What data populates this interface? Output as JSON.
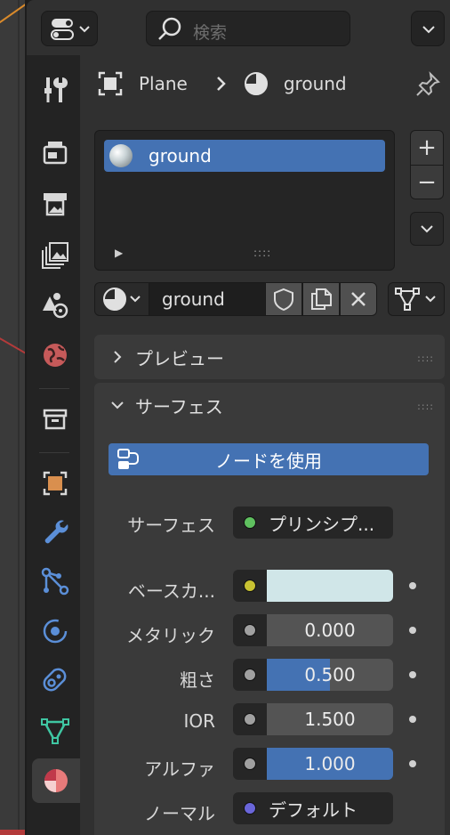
{
  "header": {
    "search_placeholder": "検索"
  },
  "breadcrumb": {
    "object": "Plane",
    "separator": "›",
    "material": "ground"
  },
  "slots": {
    "items": [
      {
        "label": "ground",
        "icon": "material-ball-icon"
      }
    ],
    "expand_glyph": "▶",
    "grip_glyph": "::::",
    "add_glyph": "+",
    "remove_glyph": "−"
  },
  "material_selector": {
    "name": "ground"
  },
  "sections": {
    "preview": {
      "title": "プレビュー"
    },
    "surface": {
      "title": "サーフェス"
    }
  },
  "surface": {
    "use_nodes_label": "ノードを使用",
    "surface_label": "サーフェス",
    "surface_shader": "プリンシプ...",
    "surface_dot_color": "#5fc05f",
    "props": [
      {
        "label": "ベースカ...",
        "type": "color",
        "color": "#d0e6e8",
        "socket": "#c8c232"
      },
      {
        "label": "メタリック",
        "type": "value",
        "value": "0.000",
        "fill": 0.0,
        "socket": "#a0a0a0"
      },
      {
        "label": "粗さ",
        "type": "value",
        "value": "0.500",
        "fill": 0.5,
        "socket": "#a0a0a0"
      },
      {
        "label": "IOR",
        "type": "value",
        "value": "1.500",
        "fill": 0.0,
        "socket": "#a0a0a0"
      },
      {
        "label": "アルファ",
        "type": "value",
        "value": "1.000",
        "fill": 1.0,
        "socket": "#a0a0a0"
      }
    ],
    "normal_label": "ノーマル",
    "normal_value": "デフォルト",
    "normal_dot_color": "#6a66d9"
  },
  "colors": {
    "accent": "#4472b3"
  }
}
